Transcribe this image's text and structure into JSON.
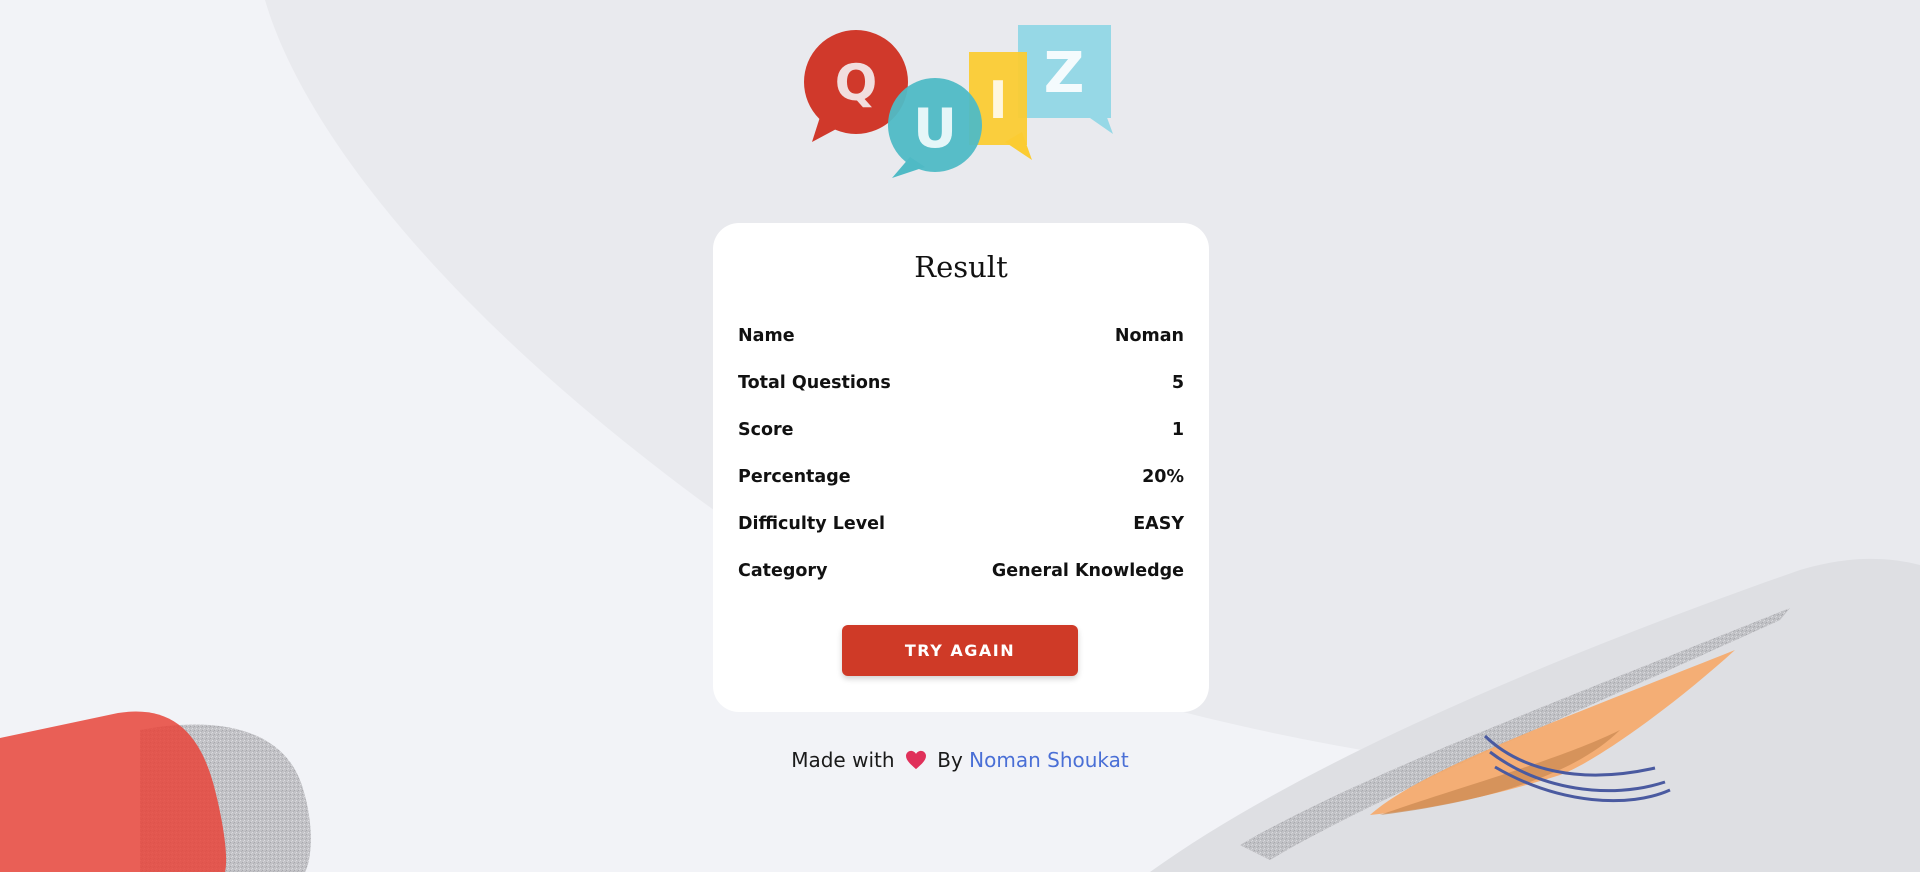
{
  "logo": {
    "letters": [
      "Q",
      "U",
      "I",
      "Z"
    ],
    "colors": {
      "red": "#d0392b",
      "teal": "#4fbac5",
      "yellow": "#fbcc33",
      "lightblue": "#96d8e6"
    }
  },
  "result": {
    "title": "Result",
    "rows": [
      {
        "label": "Name",
        "value": "Noman"
      },
      {
        "label": "Total Questions",
        "value": "5"
      },
      {
        "label": "Score",
        "value": "1"
      },
      {
        "label": "Percentage",
        "value": "20%"
      },
      {
        "label": "Difficulty Level",
        "value": "EASY"
      },
      {
        "label": "Category",
        "value": "General Knowledge"
      }
    ],
    "button_label": "TRY AGAIN"
  },
  "footer": {
    "made_with": "Made with",
    "by": "By",
    "author": "Noman Shoukat"
  },
  "icons": {
    "heart": "heart-icon"
  },
  "colors": {
    "accent": "#cf3a27",
    "link": "#4a6fd6",
    "heart": "#e0305a",
    "background": "#f2f3f7"
  }
}
